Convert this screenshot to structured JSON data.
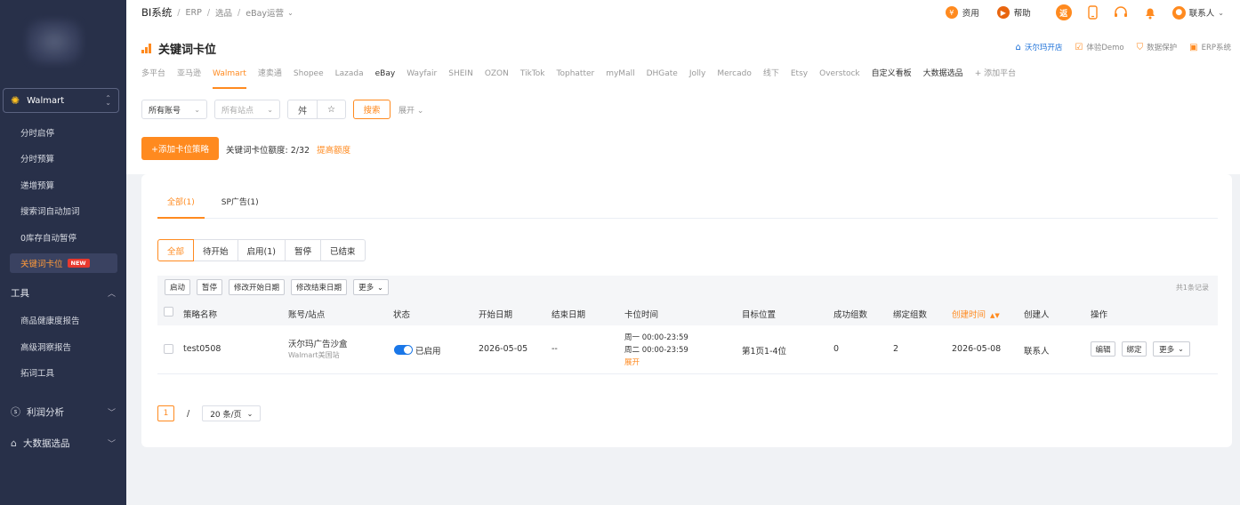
{
  "sidebar": {
    "store_select": "Walmart",
    "items": [
      {
        "label": "分时启停"
      },
      {
        "label": "分时预算"
      },
      {
        "label": "递增预算"
      },
      {
        "label": "搜索词自动加词"
      },
      {
        "label": "0库存自动暂停"
      },
      {
        "label": "关键词卡位",
        "badge": "NEW",
        "active": true
      }
    ],
    "tools_group": "工具",
    "tools_items": [
      {
        "label": "商品健康度报告"
      },
      {
        "label": "高级洞察报告"
      },
      {
        "label": "拓词工具"
      }
    ],
    "profit_group": "利润分析",
    "bigdata_group": "大数据选品"
  },
  "topbar": {
    "breadcrumb": [
      "BI系统",
      "ERP",
      "选品",
      "eBay运营"
    ],
    "fee_label": "资用",
    "help_label": "帮助",
    "fan_label": "返",
    "contact_label": "联系人"
  },
  "header": {
    "title": "关键词卡位",
    "links": [
      {
        "label": "沃尔玛开店",
        "blue": true
      },
      {
        "label": "体验Demo"
      },
      {
        "label": "数据保护"
      },
      {
        "label": "ERP系统"
      }
    ],
    "platforms": [
      {
        "label": "多平台"
      },
      {
        "label": "亚马逊"
      },
      {
        "label": "Walmart",
        "active": true
      },
      {
        "label": "速卖通"
      },
      {
        "label": "Shopee"
      },
      {
        "label": "Lazada"
      },
      {
        "label": "eBay",
        "dark": true
      },
      {
        "label": "Wayfair"
      },
      {
        "label": "SHEIN"
      },
      {
        "label": "OZON"
      },
      {
        "label": "TikTok"
      },
      {
        "label": "Tophatter"
      },
      {
        "label": "myMall"
      },
      {
        "label": "DHGate"
      },
      {
        "label": "Jolly"
      },
      {
        "label": "Mercado"
      },
      {
        "label": "线下"
      },
      {
        "label": "Etsy"
      },
      {
        "label": "Overstock"
      },
      {
        "label": "自定义看板",
        "dark": true
      },
      {
        "label": "大数据选品",
        "dark": true
      },
      {
        "label": "+ 添加平台"
      }
    ]
  },
  "filters": {
    "account": "所有账号",
    "site_placeholder": "所有站点",
    "search_btn": "搜索",
    "expand": "展开"
  },
  "actions": {
    "add_btn": "+添加卡位策略",
    "quota_label": "关键词卡位额度: 2/32",
    "quota_link": "提高额度"
  },
  "tabs": [
    {
      "label": "全部(1)",
      "active": true
    },
    {
      "label": "SP广告(1)"
    }
  ],
  "status_filters": [
    {
      "label": "全部",
      "active": true
    },
    {
      "label": "待开始"
    },
    {
      "label": "启用(1)"
    },
    {
      "label": "暂停"
    },
    {
      "label": "已结束"
    }
  ],
  "toolbar": {
    "buttons": [
      "启动",
      "暂停",
      "修改开始日期",
      "修改结束日期"
    ],
    "more": "更多",
    "total": "共1条记录"
  },
  "table": {
    "headers": {
      "name": "策略名称",
      "account": "账号/站点",
      "status": "状态",
      "start": "开始日期",
      "end": "结束日期",
      "slot_time": "卡位时间",
      "target": "目标位置",
      "success": "成功组数",
      "bound": "绑定组数",
      "created": "创建时间",
      "creator": "创建人",
      "ops": "操作"
    },
    "rows": [
      {
        "name": "test0508",
        "account": "沃尔玛广告沙盒",
        "site": "Walmart美国站",
        "status": "已启用",
        "start": "2026-05-05",
        "end": "--",
        "slot_time_1": "周一 00:00-23:59",
        "slot_time_2": "周二 00:00-23:59",
        "slot_expand": "展开",
        "target": "第1页1-4位",
        "success": "0",
        "bound": "2",
        "created": "2026-05-08",
        "creator": "联系人",
        "op_edit": "编辑",
        "op_bind": "绑定",
        "op_more": "更多"
      }
    ]
  },
  "pager": {
    "page": "1",
    "sep": "/",
    "size": "20 条/页"
  }
}
